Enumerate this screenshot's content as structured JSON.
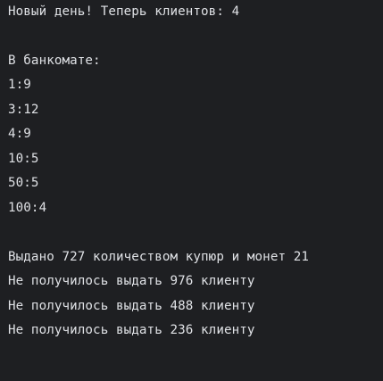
{
  "console": {
    "lines": [
      "Новый день! Теперь клиентов: 4",
      "",
      "В банкомате:",
      "1:9",
      "3:12",
      "4:9",
      "10:5",
      "50:5",
      "100:4",
      "",
      "Выдано 727 количеством купюр и монет 21",
      "Не получилось выдать 976 клиенту",
      "Не получилось выдать 488 клиенту",
      "Не получилось выдать 236 клиенту"
    ]
  },
  "colors": {
    "background": "#1e1f22",
    "text": "#dfe1e5"
  }
}
